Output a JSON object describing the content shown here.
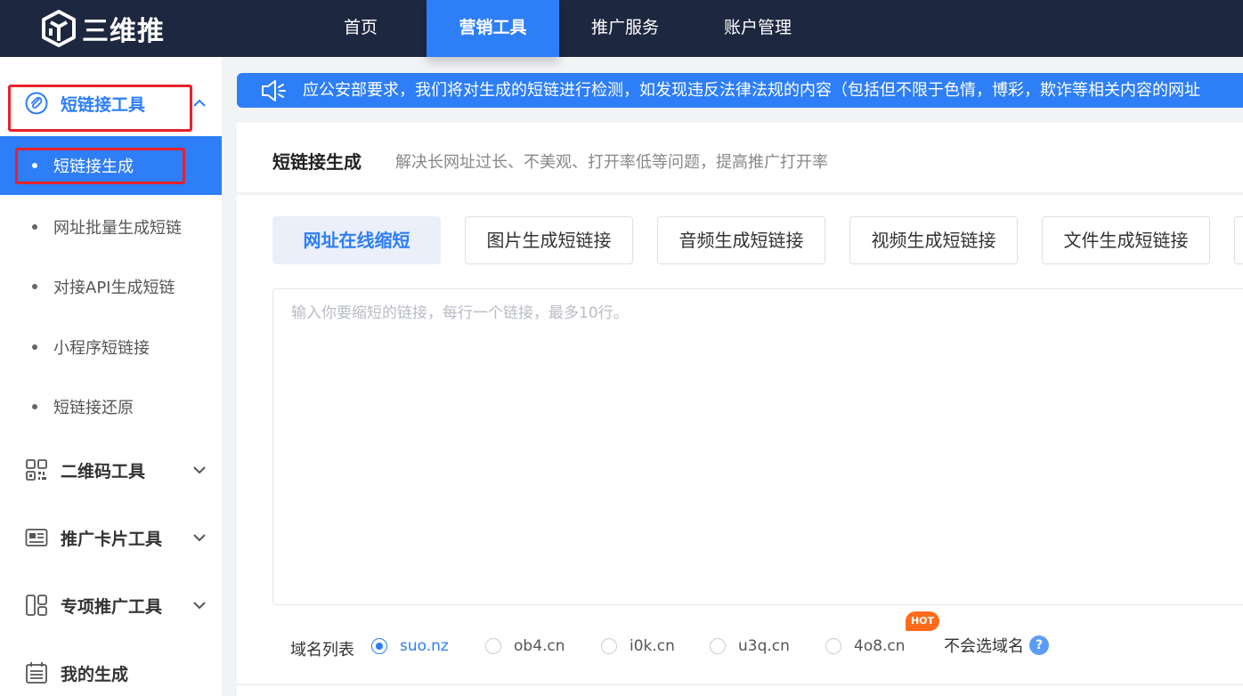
{
  "brand": {
    "name": "三维推"
  },
  "nav": {
    "items": [
      {
        "label": "首页"
      },
      {
        "label": "营销工具"
      },
      {
        "label": "推广服务"
      },
      {
        "label": "账户管理"
      }
    ],
    "active_index": 1
  },
  "sidebar": {
    "group_shortlink": {
      "label": "短链接工具",
      "icon": "paperclip-icon"
    },
    "sub_items": [
      {
        "label": "短链接生成"
      },
      {
        "label": "网址批量生成短链"
      },
      {
        "label": "对接API生成短链"
      },
      {
        "label": "小程序短链接"
      },
      {
        "label": "短链接还原"
      }
    ],
    "active_sub_index": 0,
    "group_qrcode": {
      "label": "二维码工具",
      "icon": "qrcode-icon"
    },
    "group_card": {
      "label": "推广卡片工具",
      "icon": "card-icon"
    },
    "group_special": {
      "label": "专项推广工具",
      "icon": "layout-icon"
    },
    "group_mine": {
      "label": "我的生成",
      "icon": "calendar-icon"
    }
  },
  "notice": {
    "text": "应公安部要求，我们将对生成的短链进行检测，如发现违反法律法规的内容（包括但不限于色情，博彩，欺诈等相关内容的网址"
  },
  "main": {
    "title": "短链接生成",
    "subtitle": "解决长网址过长、不美观、打开率低等问题，提高推广打开率",
    "tabs": [
      {
        "label": "网址在线缩短"
      },
      {
        "label": "图片生成短链接"
      },
      {
        "label": "音频生成短链接"
      },
      {
        "label": "视频生成短链接"
      },
      {
        "label": "文件生成短链接"
      }
    ],
    "active_tab": 0,
    "input": {
      "placeholder": "输入你要缩短的链接，每行一个链接，最多10行。",
      "value": ""
    },
    "domain": {
      "label": "域名列表",
      "options": [
        "suo.nz",
        "ob4.cn",
        "i0k.cn",
        "u3q.cn",
        "4o8.cn"
      ],
      "selected": "suo.nz",
      "hot_badge": "HOT",
      "help_text": "不会选域名",
      "help_icon": "question-icon"
    }
  },
  "colors": {
    "nav_bg": "#1e2740",
    "accent": "#2d7ef7",
    "highlight_box": "#e8202a",
    "hot": "#ff6b1a"
  }
}
